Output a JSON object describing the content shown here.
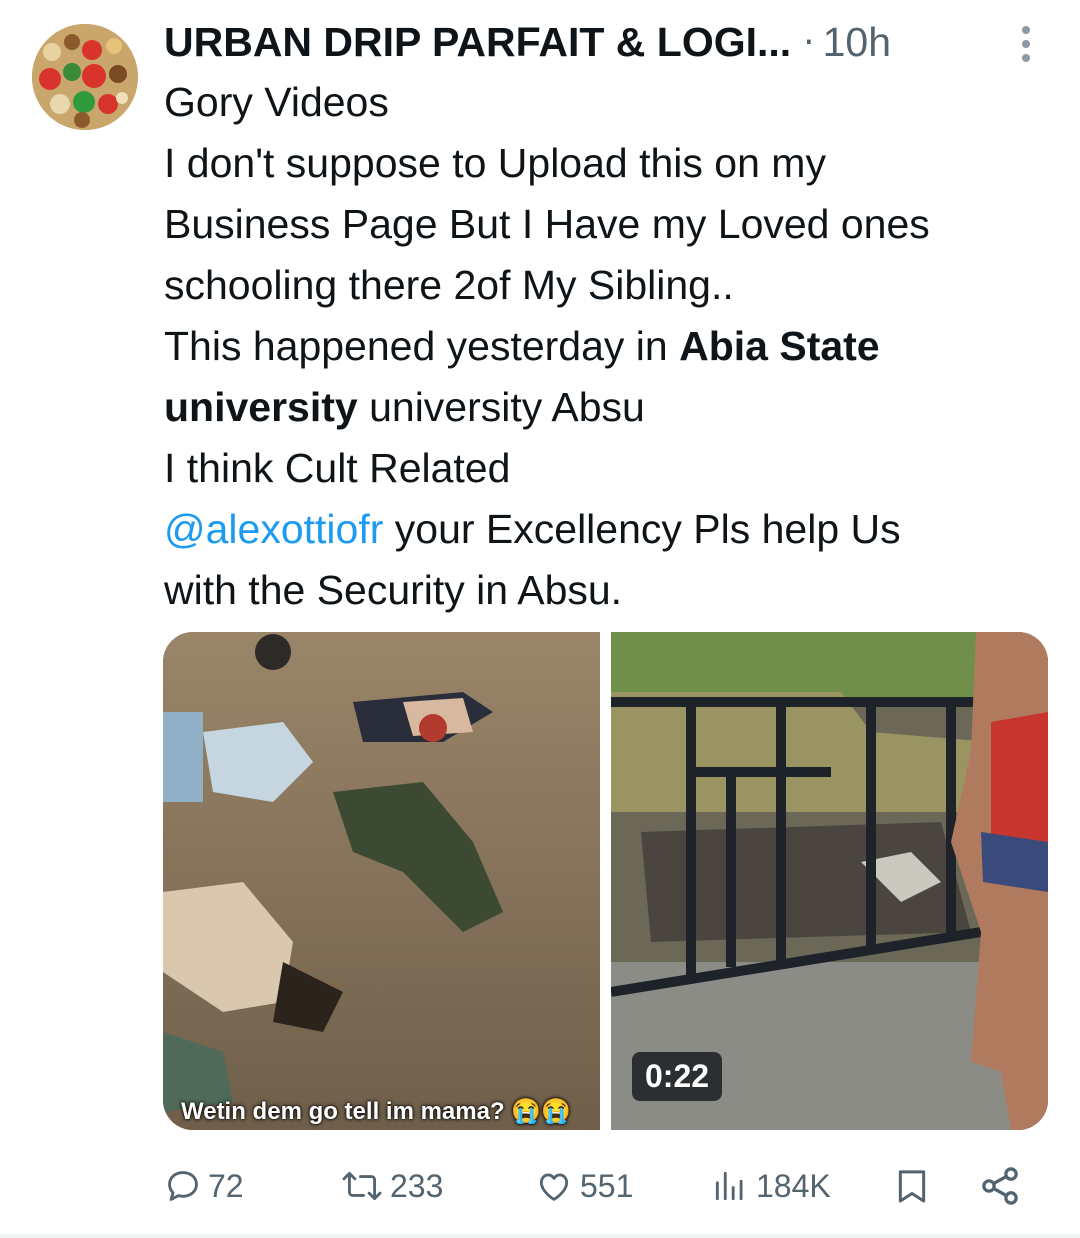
{
  "tweet": {
    "author": "URBAN DRIP PARFAIT & LOGI...",
    "separator": "·",
    "time": "10h",
    "lines": {
      "l1": "Gory Videos",
      "l2": "I don't  suppose to Upload this on my",
      "l3": "Business Page But I Have my Loved ones",
      "l4": "schooling there  2of My Sibling..",
      "l5_a": "This happened yesterday in ",
      "l5_b": "Abia State",
      "l6_a": "university",
      "l6_b": " university Absu",
      "l7": "I think Cult Related",
      "l8_mention": "@alexottiofr",
      "l8_b": " your Excellency Pls help Us",
      "l9": "with the Security in Absu."
    }
  },
  "media": {
    "left_caption": "Wetin dem go tell im mama? 😭😭",
    "video_duration": "0:22"
  },
  "actions": {
    "replies": "72",
    "reposts": "233",
    "likes": "551",
    "views": "184K"
  },
  "icons": [
    "more-options-icon",
    "reply-icon",
    "repost-icon",
    "like-icon",
    "views-icon",
    "bookmark-icon",
    "share-icon"
  ],
  "colors": {
    "link": "#1d9bf0",
    "muted": "#536471",
    "text": "#0f1419"
  }
}
